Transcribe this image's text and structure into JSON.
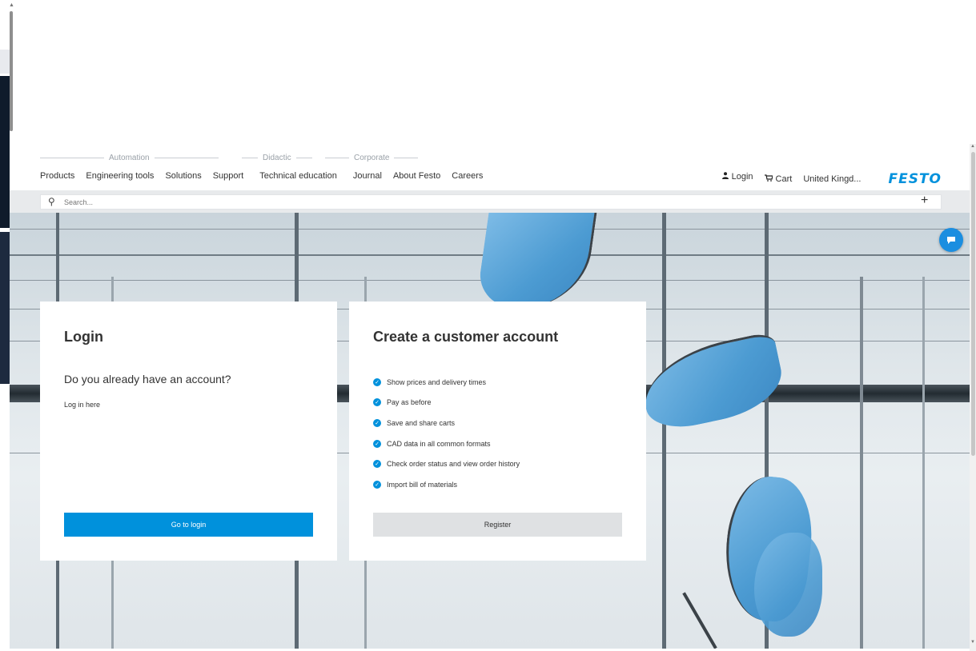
{
  "header": {
    "groups": [
      {
        "label": "Automation"
      },
      {
        "label": "Didactic"
      },
      {
        "label": "Corporate"
      }
    ],
    "nav": [
      {
        "label": "Products"
      },
      {
        "label": "Engineering tools"
      },
      {
        "label": "Solutions"
      },
      {
        "label": "Support"
      },
      {
        "label": "Technical education"
      },
      {
        "label": "Journal"
      },
      {
        "label": "About Festo"
      },
      {
        "label": "Careers"
      }
    ],
    "login_label": "Login",
    "cart_label": "Cart",
    "country_label": "United Kingd...",
    "logo_text": "FESTO"
  },
  "search": {
    "placeholder": "Search...",
    "plus_icon": "plus-icon"
  },
  "login_card": {
    "title": "Login",
    "subtitle": "Do you already have an account?",
    "text": "Log in here",
    "button_label": "Go to login"
  },
  "register_card": {
    "title": "Create a customer account",
    "benefits": [
      {
        "label": "Show prices and delivery times"
      },
      {
        "label": "Pay as before"
      },
      {
        "label": "Save and share carts"
      },
      {
        "label": "CAD data in all common formats"
      },
      {
        "label": "Check order status and view order history"
      },
      {
        "label": "Import bill of materials"
      }
    ],
    "button_label": "Register"
  },
  "colors": {
    "accent": "#0091dc",
    "secondary_button": "#dfe1e3"
  }
}
